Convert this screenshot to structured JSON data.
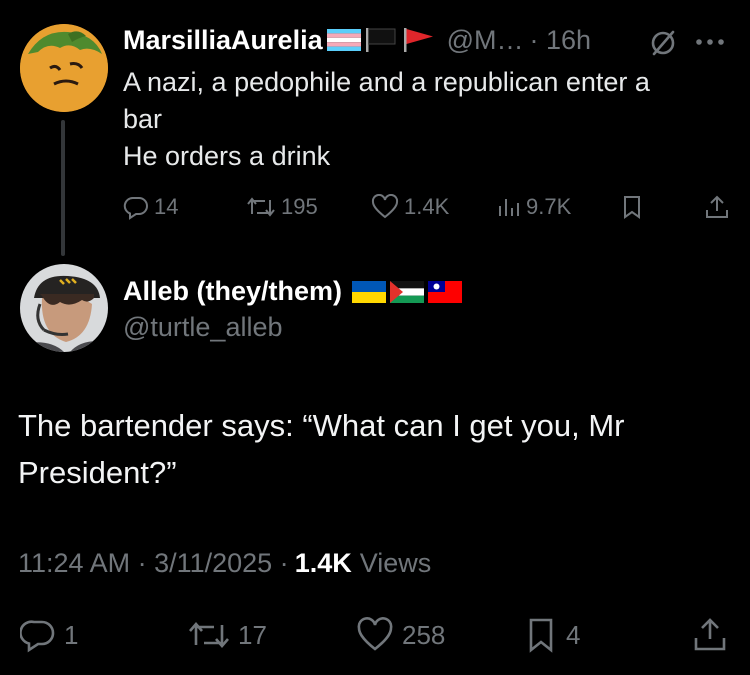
{
  "parent_tweet": {
    "name": "MarsilliaAurelia",
    "handle": "@M…",
    "time": "· 16h",
    "flags": [
      "transgender-pride-flag",
      "black-flag",
      "red-flag"
    ],
    "text_lines": [
      "A nazi, a pedophile and a republican enter a",
      "bar",
      "He orders a drink"
    ],
    "stats": {
      "replies": "14",
      "reposts": "195",
      "likes": "1.4K",
      "views": "9.7K"
    }
  },
  "reply_tweet": {
    "name": "Alleb (they/them)",
    "handle": "@turtle_alleb",
    "flags": [
      "ukraine-flag",
      "palestine-flag",
      "taiwan-flag"
    ],
    "text_lines": [
      "The bartender says: “What can I get you, Mr",
      "President?”"
    ],
    "timestamp": "11:24 AM · 3/11/2025 ·",
    "views_count": "1.4K",
    "views_label": "Views",
    "stats": {
      "replies": "1",
      "reposts": "17",
      "likes": "258",
      "bookmarks": "4"
    }
  },
  "colors": {
    "background": "#000000",
    "text": "#e7e9ea",
    "muted": "#71767b"
  }
}
